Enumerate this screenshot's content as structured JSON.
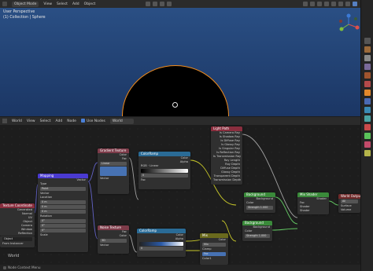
{
  "viewport_header": {
    "mode": "Object Mode",
    "menus": [
      "View",
      "Select",
      "Add",
      "Object"
    ]
  },
  "viewport": {
    "perspective": "User Perspective",
    "collection": "(1) Collection | Sphere"
  },
  "node_header": {
    "editor_type": "World",
    "menus": [
      "View",
      "Select",
      "Add",
      "Node"
    ],
    "use_nodes": "Use Nodes",
    "world_name": "World"
  },
  "canvas_label": "World",
  "nodes": {
    "texture_coordinate": {
      "title": "Texture Coordinate",
      "outputs": [
        "Generated",
        "Normal",
        "UV",
        "Object",
        "Camera",
        "Window",
        "Reflection"
      ],
      "object_label": "Object",
      "from_instancer": "From Instancer"
    },
    "mapping": {
      "title": "Mapping",
      "vector_label": "Vector",
      "type_label": "Type",
      "type_value": "Point",
      "location_label": "Location",
      "rotation_label": "Rotation",
      "scale_label": "Scale",
      "loc": [
        "0 m",
        "0 m",
        "0 m"
      ],
      "rot": [
        "0°",
        "0°",
        "0°"
      ],
      "scale": [
        "1",
        "1",
        "1"
      ]
    },
    "gradient": {
      "title": "Gradient Texture",
      "outputs": [
        "Color",
        "Fac"
      ],
      "type": "Linear",
      "vector": "Vector"
    },
    "colorramp_top": {
      "title": "ColorRamp",
      "outputs": [
        "Color",
        "Alpha"
      ],
      "mode": "RGB",
      "interp": "Linear",
      "pos": "0",
      "fac": "Fac"
    },
    "colorramp_bottom": {
      "title": "ColorRamp",
      "outputs": [
        "Color",
        "Alpha"
      ],
      "mode": "RGB",
      "interp": "Linear",
      "pos": "0",
      "fac": "Fac"
    },
    "noise": {
      "title": "Noise Texture",
      "outputs": [
        "Fac",
        "Color"
      ],
      "dim": "3D",
      "fields": [
        "Vector",
        "Scale",
        "Detail",
        "Roughness",
        "Distortion"
      ],
      "values": [
        "",
        "100.000",
        "2.000",
        "0.500",
        "0.000"
      ]
    },
    "light_path": {
      "title": "Light Path",
      "outputs": [
        "Is Camera Ray",
        "Is Shadow Ray",
        "Is Diffuse Ray",
        "Is Glossy Ray",
        "Is Singular Ray",
        "Is Reflection Ray",
        "Is Transmission Ray",
        "Ray Length",
        "Ray Depth",
        "Diffuse Depth",
        "Glossy Depth",
        "Transparent Depth",
        "Transmission Depth"
      ]
    },
    "background_1": {
      "title": "Background",
      "output": "Background",
      "color": "Color",
      "strength_label": "Strength",
      "strength": "1.000"
    },
    "background_2": {
      "title": "Background",
      "output": "Background",
      "color": "Color",
      "strength_label": "Strength",
      "strength": "1.000"
    },
    "mix_shader": {
      "title": "Mix Shader",
      "output": "Shader",
      "inputs": [
        "Fac",
        "Shader",
        "Shader"
      ]
    },
    "mix": {
      "title": "Mix",
      "output": "Color",
      "blend": "Mix",
      "clamp": "Clamp",
      "inputs": [
        "Fac",
        "Color1",
        "Color2"
      ]
    },
    "world_output": {
      "title": "World Output",
      "target": "All",
      "inputs": [
        "Surface",
        "Volume"
      ]
    }
  },
  "status": {
    "items": [
      "Node Context Menu"
    ]
  },
  "colors": {
    "texture_header": "#7d3b49",
    "vector_header": "#4a3ad0",
    "converter_header": "#2a6b96",
    "input_header": "#8a2e3e",
    "shader_header": "#3a8a3a",
    "output_header": "#712a2a",
    "color_header": "#6a6a1d",
    "selection": "#f18c1c"
  }
}
